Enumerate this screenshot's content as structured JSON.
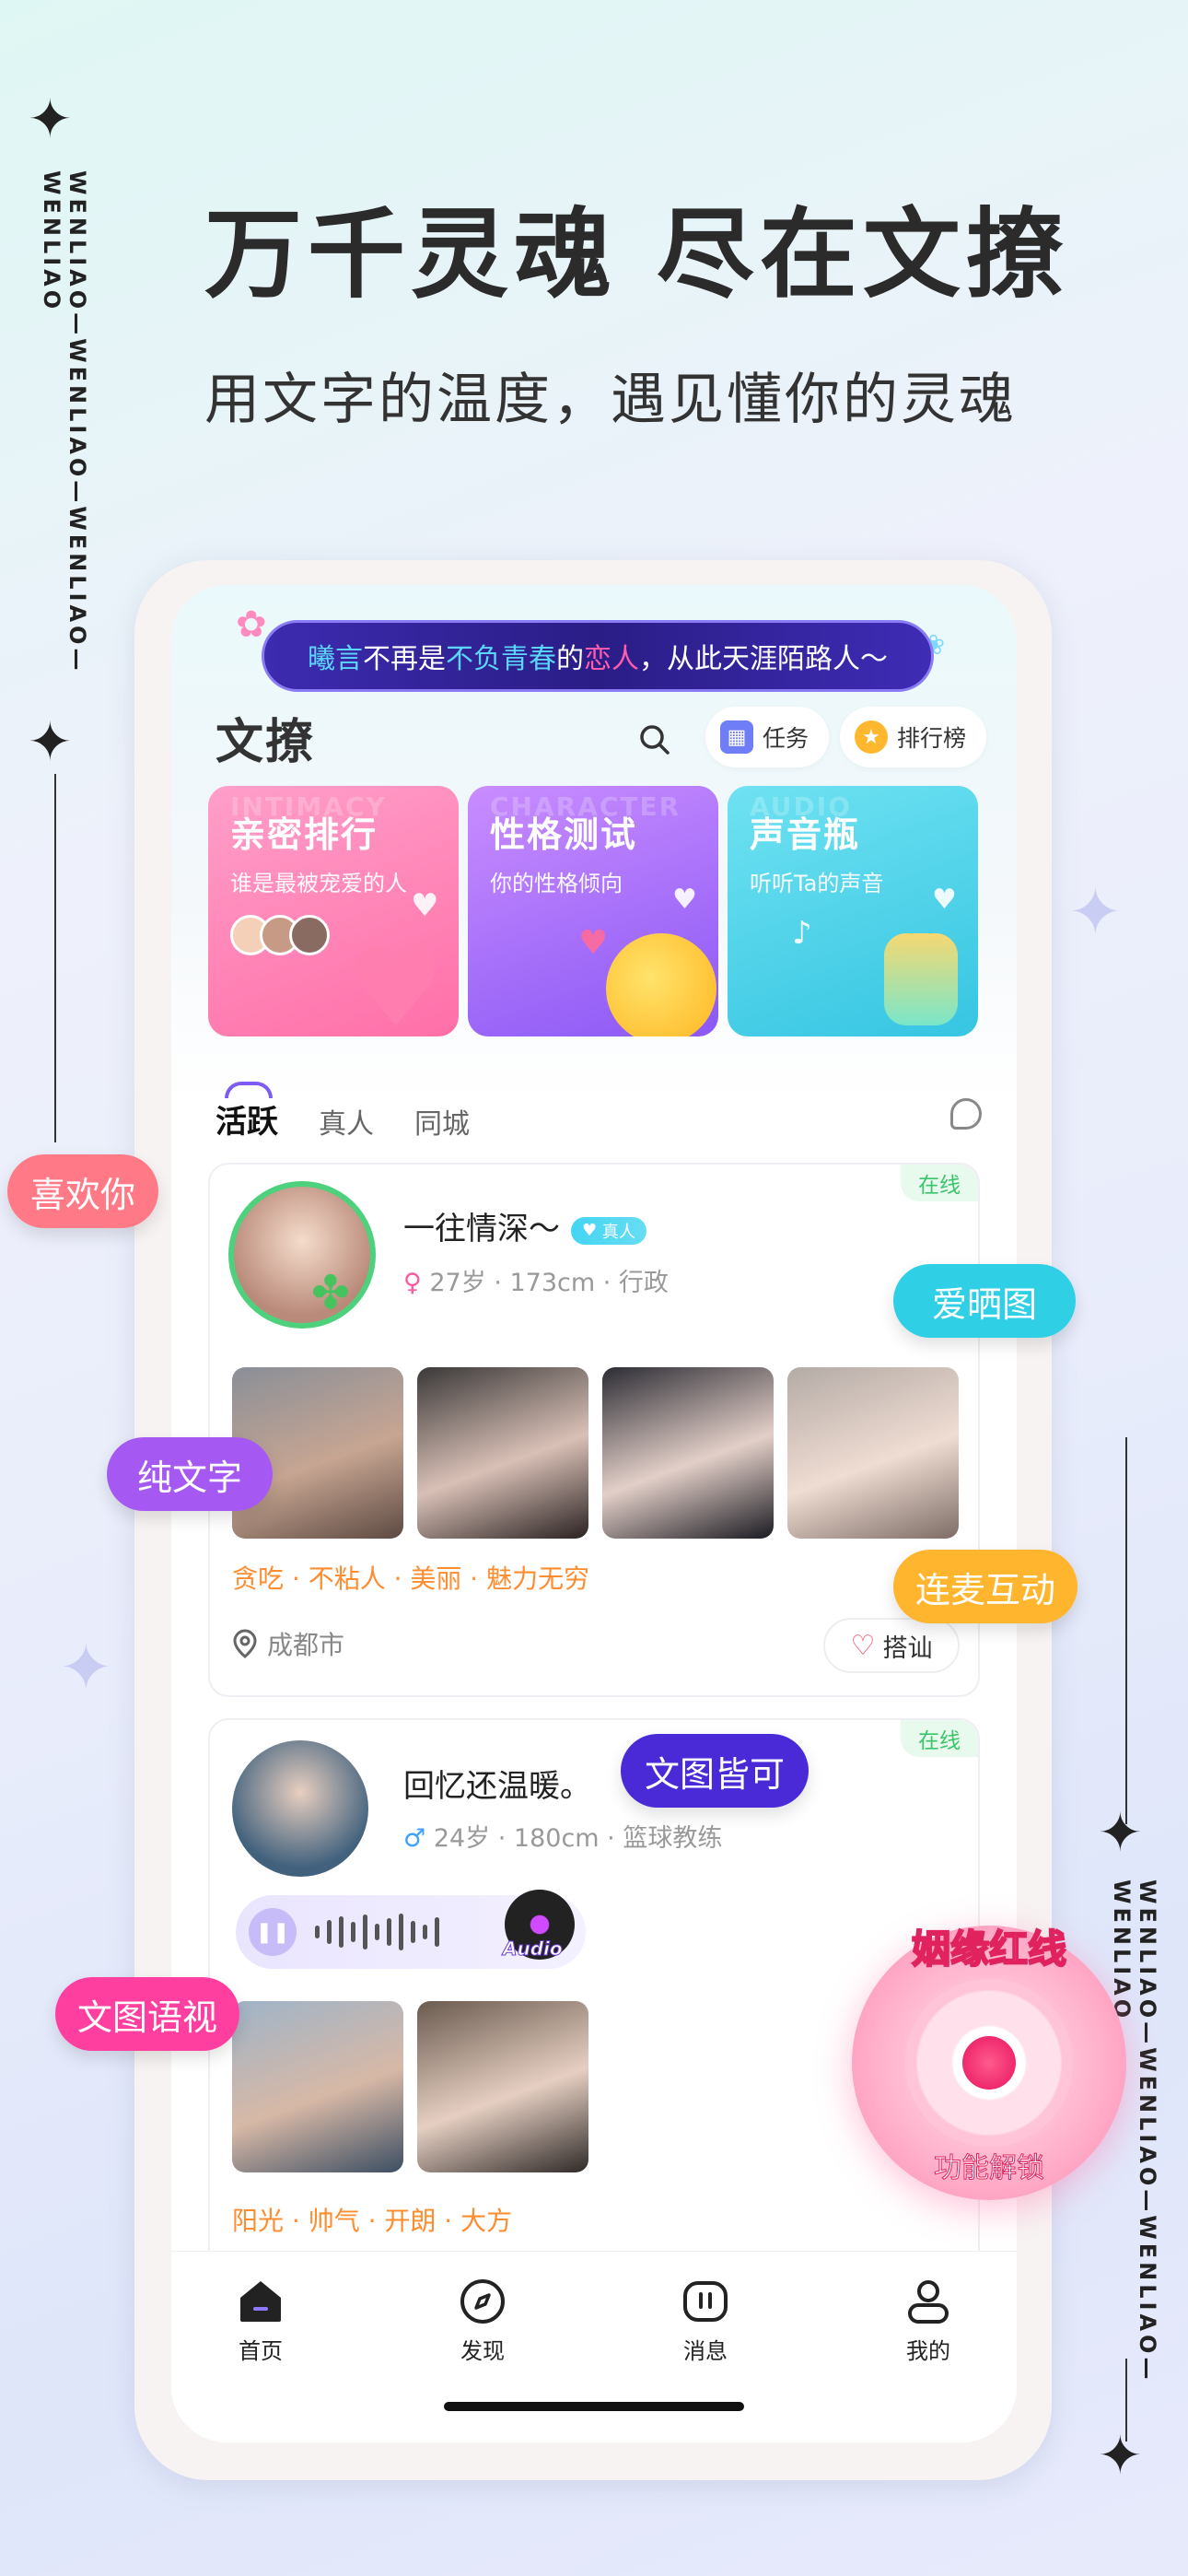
{
  "hero": {
    "title": "万千灵魂  尽在文撩",
    "subtitle": "用文字的温度，遇见懂你的灵魂"
  },
  "side_text": {
    "left": "WENLIAO—WENLIAO—WENLIAO—WENLIAO",
    "right": "WENLIAO—WENLIAO—WENLIAO—WENLIAO"
  },
  "banner": {
    "part1": "曦言",
    "part2": " 不再是 ",
    "part3": "不负青春",
    "part4": " 的 ",
    "part5": "恋人",
    "part6": "，从此天涯陌路人～"
  },
  "header": {
    "logo": "文撩",
    "task_label": "任务",
    "rank_label": "排行榜"
  },
  "features": [
    {
      "title": "亲密排行",
      "ghost": "INTIMACY",
      "subtitle": "谁是最被宠爱的人"
    },
    {
      "title": "性格测试",
      "ghost": "CHARACTER",
      "subtitle": "你的性格倾向"
    },
    {
      "title": "声音瓶",
      "ghost": "AUDIO",
      "subtitle": "听听Ta的声音"
    }
  ],
  "tabs": [
    "活跃",
    "真人",
    "同城"
  ],
  "users": [
    {
      "name": "一往情深～",
      "badge": "真人",
      "status": "在线",
      "gender_icon": "♀",
      "meta": "27岁 · 173cm · 行政",
      "tags": "贪吃 · 不粘人 · 美丽 · 魅力无穷",
      "location": "成都市",
      "greet": "搭讪"
    },
    {
      "name": "回忆还温暖。",
      "status": "在线",
      "gender_icon": "♂",
      "meta": "24岁 · 180cm · 篮球教练",
      "tags": "阳光 · 帅气 · 开朗 · 大方",
      "audio_label": "Audio"
    }
  ],
  "nav": [
    "首页",
    "发现",
    "消息",
    "我的"
  ],
  "floating_labels": {
    "like": "喜欢你",
    "show_pics": "爱晒图",
    "pure_text": "纯文字",
    "voice_chat": "连麦互动",
    "text_pic": "文图皆可",
    "multi": "文图语视"
  },
  "redline": {
    "title": "姻缘红线",
    "subtitle": "功能解锁"
  },
  "colors": {
    "accent_purple": "#7d5cf3",
    "tag_orange": "#ff8c2e",
    "online_green": "#3cc46b"
  }
}
